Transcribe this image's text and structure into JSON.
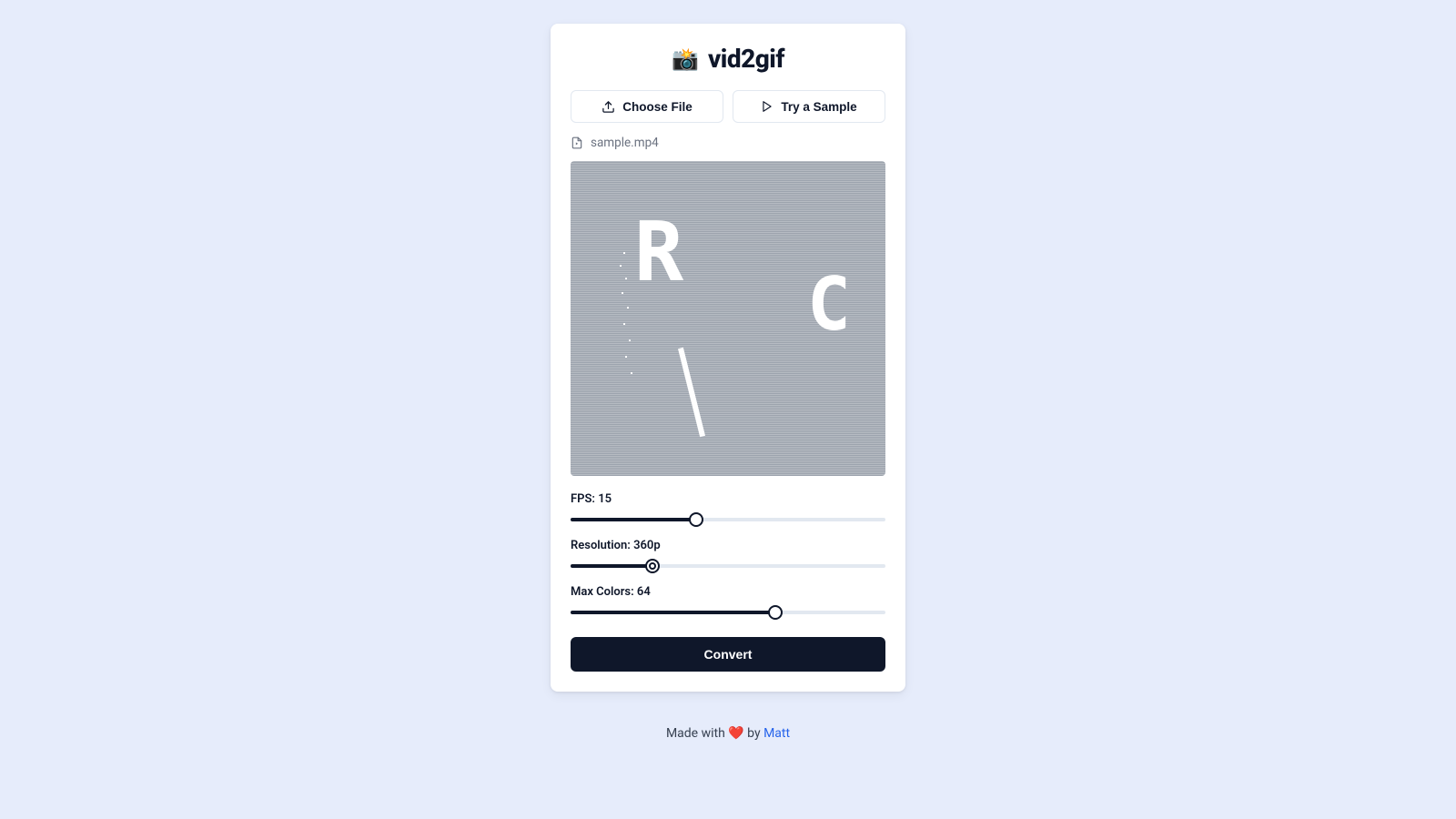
{
  "app": {
    "title": "vid2gif",
    "emoji": "📸"
  },
  "actions": {
    "choose_file": "Choose File",
    "try_sample": "Try a Sample",
    "convert": "Convert"
  },
  "file": {
    "name": "sample.mp4"
  },
  "controls": {
    "fps": {
      "label": "FPS: 15",
      "value": 15,
      "min": 1,
      "max": 40,
      "fill_pct": 40
    },
    "resolution": {
      "label": "Resolution: 360p",
      "value": "360p",
      "fill_pct": 26
    },
    "colors": {
      "label": "Max Colors: 64",
      "value": 64,
      "fill_pct": 65
    }
  },
  "footer": {
    "prefix": "Made with ",
    "heart": "❤️",
    "by": " by ",
    "author": "Matt"
  },
  "icons": {
    "upload": "upload-icon",
    "play": "play-icon",
    "file": "file-icon",
    "camera": "camera-icon"
  }
}
